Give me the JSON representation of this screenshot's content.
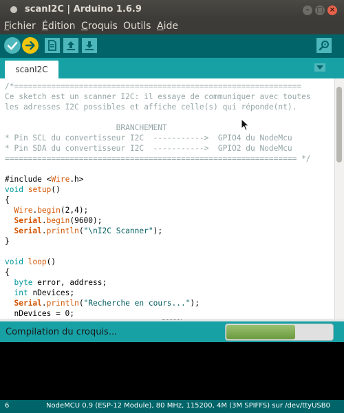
{
  "window": {
    "title": "scanI2C | Arduino 1.6.9"
  },
  "menu": [
    {
      "mnemonic": "F",
      "rest": "ichier"
    },
    {
      "mnemonic": "É",
      "rest": "dition"
    },
    {
      "mnemonic": "C",
      "rest": "roquis"
    },
    {
      "mnemonic": "O",
      "rest": "utils",
      "pre": ""
    },
    {
      "mnemonic": "A",
      "rest": "ide"
    }
  ],
  "menu_labels": [
    "Fichier",
    "Édition",
    "Croquis",
    "Outils",
    "Aide"
  ],
  "toolbar": {
    "icons": [
      "verify-icon",
      "upload-icon",
      "new-icon",
      "open-icon",
      "save-icon",
      "serial-monitor-icon"
    ]
  },
  "tabs": [
    {
      "label": "scanI2C",
      "active": true
    }
  ],
  "editor": {
    "lines": [
      [
        [
          "cm",
          "/*=============================================================="
        ]
      ],
      [
        [
          "cm",
          "Ce sketch est un scanner I2C: il essaye de communiquer avec toutes"
        ]
      ],
      [
        [
          "cm",
          "les adresses I2C possibles et affiche celle(s) qui réponde(nt)."
        ]
      ],
      [
        [
          "",
          ""
        ]
      ],
      [
        [
          "cm",
          "                        BRANCHEMENT"
        ]
      ],
      [
        [
          "cm",
          "* Pin SCL du convertisseur I2C  ----------->  GPIO4 du NodeMcu"
        ]
      ],
      [
        [
          "cm",
          "* Pin SDA du convertisseur I2C  ----------->  GPIO2 du NodeMcu"
        ]
      ],
      [
        [
          "cm",
          "=============================================================== */"
        ]
      ],
      [
        [
          "",
          ""
        ]
      ],
      [
        [
          "",
          "#include <"
        ],
        [
          "fn",
          "Wire"
        ],
        [
          "",
          ".h>"
        ]
      ],
      [
        [
          "kw",
          "void"
        ],
        [
          "",
          " "
        ],
        [
          "fn",
          "setup"
        ],
        [
          "",
          "()"
        ]
      ],
      [
        [
          "",
          "{"
        ]
      ],
      [
        [
          "",
          "  "
        ],
        [
          "fn",
          "Wire"
        ],
        [
          "",
          "."
        ],
        [
          "fn",
          "begin"
        ],
        [
          "",
          "(2,4);"
        ]
      ],
      [
        [
          "",
          "  "
        ],
        [
          "cl",
          "Serial"
        ],
        [
          "",
          "."
        ],
        [
          "fn",
          "begin"
        ],
        [
          "",
          "(9600);"
        ]
      ],
      [
        [
          "",
          "  "
        ],
        [
          "cl",
          "Serial"
        ],
        [
          "",
          "."
        ],
        [
          "fn",
          "println"
        ],
        [
          "",
          "("
        ],
        [
          "st",
          "\"\\nI2C Scanner\""
        ],
        [
          "",
          ");"
        ]
      ],
      [
        [
          "",
          "}"
        ]
      ],
      [
        [
          "",
          ""
        ]
      ],
      [
        [
          "kw",
          "void"
        ],
        [
          "",
          " "
        ],
        [
          "fn",
          "loop"
        ],
        [
          "",
          "()"
        ]
      ],
      [
        [
          "",
          "{"
        ]
      ],
      [
        [
          "",
          "  "
        ],
        [
          "kw",
          "byte"
        ],
        [
          "",
          " error, address;"
        ]
      ],
      [
        [
          "",
          "  "
        ],
        [
          "kw",
          "int"
        ],
        [
          "",
          " nDevices;"
        ]
      ],
      [
        [
          "",
          "  "
        ],
        [
          "cl",
          "Serial"
        ],
        [
          "",
          "."
        ],
        [
          "fn",
          "println"
        ],
        [
          "",
          "("
        ],
        [
          "st",
          "\"Recherche en cours...\""
        ],
        [
          "",
          ");"
        ]
      ],
      [
        [
          "",
          "  nDevices = 0;"
        ]
      ]
    ]
  },
  "status": {
    "text": "Compilation du croquis...",
    "progress": 0.65
  },
  "bottom": {
    "line_number": "6",
    "board_info": "NodeMCU 0.9 (ESP-12 Module), 80 MHz, 115200, 4M (3M SPIFFS) sur /dev/ttyUSB0"
  },
  "colors": {
    "toolbar": "#006468",
    "tabs": "#17a1a5",
    "button": "#4db7bb",
    "upload": "#f1c40f",
    "comment": "#95a5a6",
    "keyword": "#00979c",
    "function": "#d35400",
    "string": "#005c5f"
  }
}
